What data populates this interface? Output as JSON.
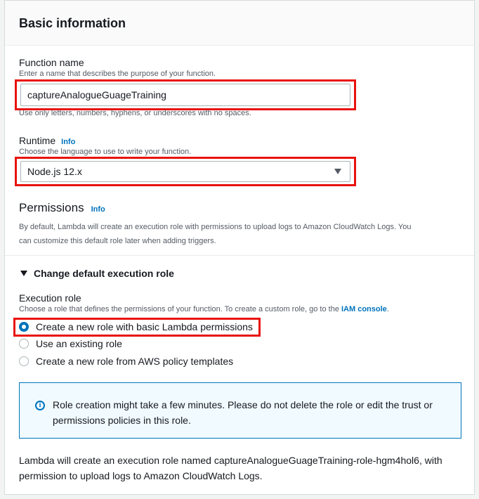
{
  "section": {
    "title": "Basic information"
  },
  "function_name": {
    "label": "Function name",
    "description": "Enter a name that describes the purpose of your function.",
    "value": "captureAnalogueGuageTraining",
    "constraint": "Use only letters, numbers, hyphens, or underscores with no spaces."
  },
  "runtime": {
    "label": "Runtime",
    "info": "Info",
    "description": "Choose the language to use to write your function.",
    "selected": "Node.js 12.x"
  },
  "permissions": {
    "title": "Permissions",
    "info": "Info",
    "description_line1": "By default, Lambda will create an execution role with permissions to upload logs to Amazon CloudWatch Logs. You",
    "description_line2": "can customize this default role later when adding triggers."
  },
  "execution_role": {
    "expander_label": "Change default execution role",
    "label": "Execution role",
    "description": "Choose a role that defines the permissions of your function. To create a custom role, go to the ",
    "iam_link": "IAM console",
    "description_end": ".",
    "options": [
      {
        "label": "Create a new role with basic Lambda permissions",
        "checked": true
      },
      {
        "label": "Use an existing role",
        "checked": false
      },
      {
        "label": "Create a new role from AWS policy templates",
        "checked": false
      }
    ]
  },
  "info_alert": {
    "line1": "Role creation might take a few minutes. Please do not delete the role or edit the trust or",
    "line2": "permissions policies in this role."
  },
  "footer_note": {
    "line1": "Lambda will create an execution role named captureAnalogueGuageTraining-role-hgm4hol6, with",
    "line2": "permission to upload logs to Amazon CloudWatch Logs."
  },
  "colors": {
    "accent": "#0073bb",
    "highlight": "#e8120c"
  }
}
